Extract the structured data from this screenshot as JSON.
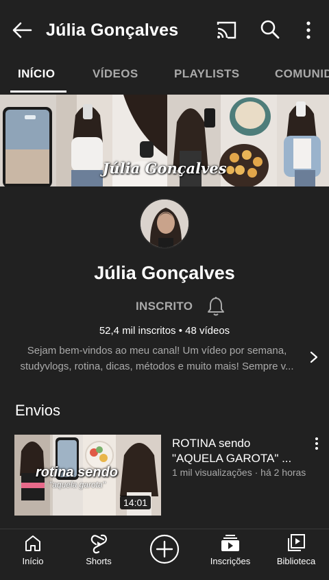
{
  "header": {
    "title": "Júlia Gonçalves",
    "back_icon": "arrow-left-icon",
    "cast_icon": "cast-icon",
    "search_icon": "search-icon",
    "more_icon": "more-vertical-icon"
  },
  "tabs": [
    {
      "label": "INÍCIO",
      "active": true
    },
    {
      "label": "VÍDEOS",
      "active": false
    },
    {
      "label": "PLAYLISTS",
      "active": false
    },
    {
      "label": "COMUNIDADE",
      "active": false
    }
  ],
  "banner": {
    "title": "Júlia Gonçalves"
  },
  "channel": {
    "name": "Júlia Gonçalves",
    "subscribe_label": "INSCRITO",
    "stats": "52,4 mil inscritos • 48 vídeos",
    "description_line1": "Sejam bem-vindos ao meu canal! Um vídeo por semana,",
    "description_line2": "studyvlogs, rotina, dicas, métodos e muito mais! Sempre v..."
  },
  "uploads": {
    "section_title": "Envios",
    "videos": [
      {
        "title_line1": "ROTINA sendo",
        "title_line2": "\"AQUELA GAROTA\" ...",
        "meta": "1 mil visualizações · há 2 horas",
        "duration": "14:01",
        "thumb_text_1": "rotina sendo",
        "thumb_text_2": "\"aquela garota\""
      }
    ]
  },
  "bottom_nav": [
    {
      "label": "Início",
      "icon": "home-icon"
    },
    {
      "label": "Shorts",
      "icon": "shorts-icon"
    },
    {
      "label": "",
      "icon": "create-plus-icon"
    },
    {
      "label": "Inscrições",
      "icon": "subscriptions-icon"
    },
    {
      "label": "Biblioteca",
      "icon": "library-icon"
    }
  ],
  "colors": {
    "background": "#212121",
    "text_primary": "#ffffff",
    "text_secondary": "#aaaaaa"
  }
}
